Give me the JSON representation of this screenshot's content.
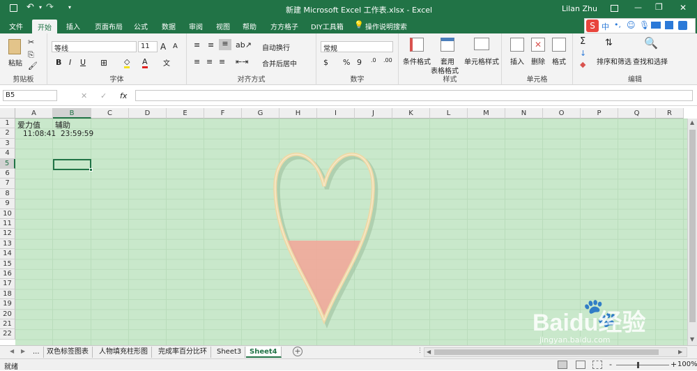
{
  "titlebar": {
    "title": "新建 Microsoft Excel 工作表.xlsx - Excel",
    "user": "Lilan Zhu",
    "restore_icon": "ribbon-display-icon",
    "minimize": "—",
    "maximize": "❐",
    "close": "✕"
  },
  "tabs": [
    "文件",
    "开始",
    "插入",
    "页面布局",
    "公式",
    "数据",
    "审阅",
    "视图",
    "帮助",
    "方方格子",
    "DIY工具箱",
    "操作说明搜索"
  ],
  "ribbon": {
    "clipboard": {
      "paste": "粘贴",
      "label": "剪贴板"
    },
    "font": {
      "name": "等线",
      "size": "11",
      "label": "字体",
      "bold": "B",
      "italic": "I",
      "underline": "U",
      "grow": "A",
      "shrink": "A"
    },
    "align": {
      "wrap": "自动换行",
      "merge": "合并后居中",
      "label": "对齐方式"
    },
    "number": {
      "format": "常规",
      "label": "数字",
      "percent": "%",
      "comma": "9"
    },
    "styles": {
      "cond": "条件格式",
      "table": "套用",
      "table2": "表格格式",
      "cell": "单元格样式",
      "label": "样式"
    },
    "cells": {
      "insert": "插入",
      "delete": "删除",
      "format": "格式",
      "label": "单元格"
    },
    "edit": {
      "sort": "排序和筛选",
      "find": "查找和选择",
      "label": "编辑"
    }
  },
  "formula": {
    "namebox": "B5",
    "fx": "fx",
    "value": ""
  },
  "columns": [
    "A",
    "B",
    "C",
    "D",
    "E",
    "F",
    "G",
    "H",
    "I",
    "J",
    "K",
    "L",
    "M",
    "N",
    "O",
    "P",
    "Q",
    "R"
  ],
  "rows": [
    "1",
    "2",
    "3",
    "4",
    "5",
    "6",
    "7",
    "8",
    "9",
    "10",
    "11",
    "12",
    "13",
    "14",
    "15",
    "16",
    "17",
    "18",
    "19",
    "20",
    "21",
    "22"
  ],
  "cells": {
    "a1": "爱力值",
    "b1": "辅助",
    "a2": "11:08:41",
    "b2": "23:59:59"
  },
  "sheets": [
    "...",
    "双色标签图表",
    "人物填充柱形图",
    "完成率百分比环",
    "Sheet3",
    "Sheet4"
  ],
  "active_sheet": "Sheet4",
  "status": {
    "ready": "就绪",
    "zoom": "100%",
    "minus": "-",
    "plus": "+"
  },
  "watermark": {
    "brand": "Baidu经验",
    "url": "jingyan.baidu.com"
  },
  "colors": {
    "excel_green": "#217346",
    "sheet_bg": "#c9e8cb",
    "heart_fill": "#f1a99a"
  }
}
